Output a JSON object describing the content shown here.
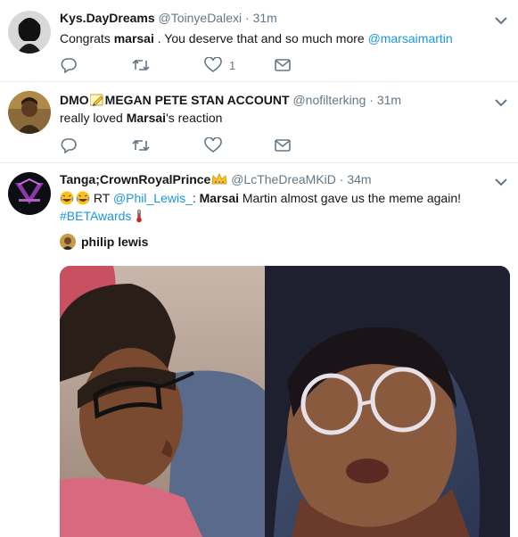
{
  "tweets": [
    {
      "display_name": "Kys.DayDreams",
      "handle": "@ToinyeDalexi",
      "separator": "·",
      "time": "31m",
      "text_1": "Congrats ",
      "text_bold": "marsai",
      "text_2": " . You deserve that and so much more ",
      "text_link": "@marsaimartin",
      "like_count": "1"
    },
    {
      "display_name_1": "DMO",
      "display_name_2": "MEGAN PETE STAN ACCOUNT",
      "handle": "@nofilterking",
      "separator": "·",
      "time": "31m",
      "text_1": "really loved ",
      "text_bold": "Marsai",
      "text_2": "'s reaction"
    },
    {
      "display_name": "Tanga;CrownRoyalPrince",
      "handle": "@LcTheDreaMKiD",
      "separator": "·",
      "time": "34m",
      "rt": " RT ",
      "rt_handle": "@Phil_Lewis_",
      "colon": ": ",
      "text_bold": "Marsai",
      "text_2": " Martin almost gave us the meme again!",
      "hashtag": "#BETAwards",
      "quoted_author": "philip lewis"
    }
  ],
  "icons": [
    "reply-icon",
    "retweet-icon",
    "like-icon",
    "dm-icon",
    "chevron-down-icon",
    "pencil-emoji-icon",
    "crown-emoji-icon",
    "laughing-emoji-icon",
    "thermometer-emoji-icon"
  ],
  "colors": {
    "link": "#1b95e0",
    "muted": "#657786",
    "text": "#14171a",
    "divider": "#e6ecf0"
  }
}
